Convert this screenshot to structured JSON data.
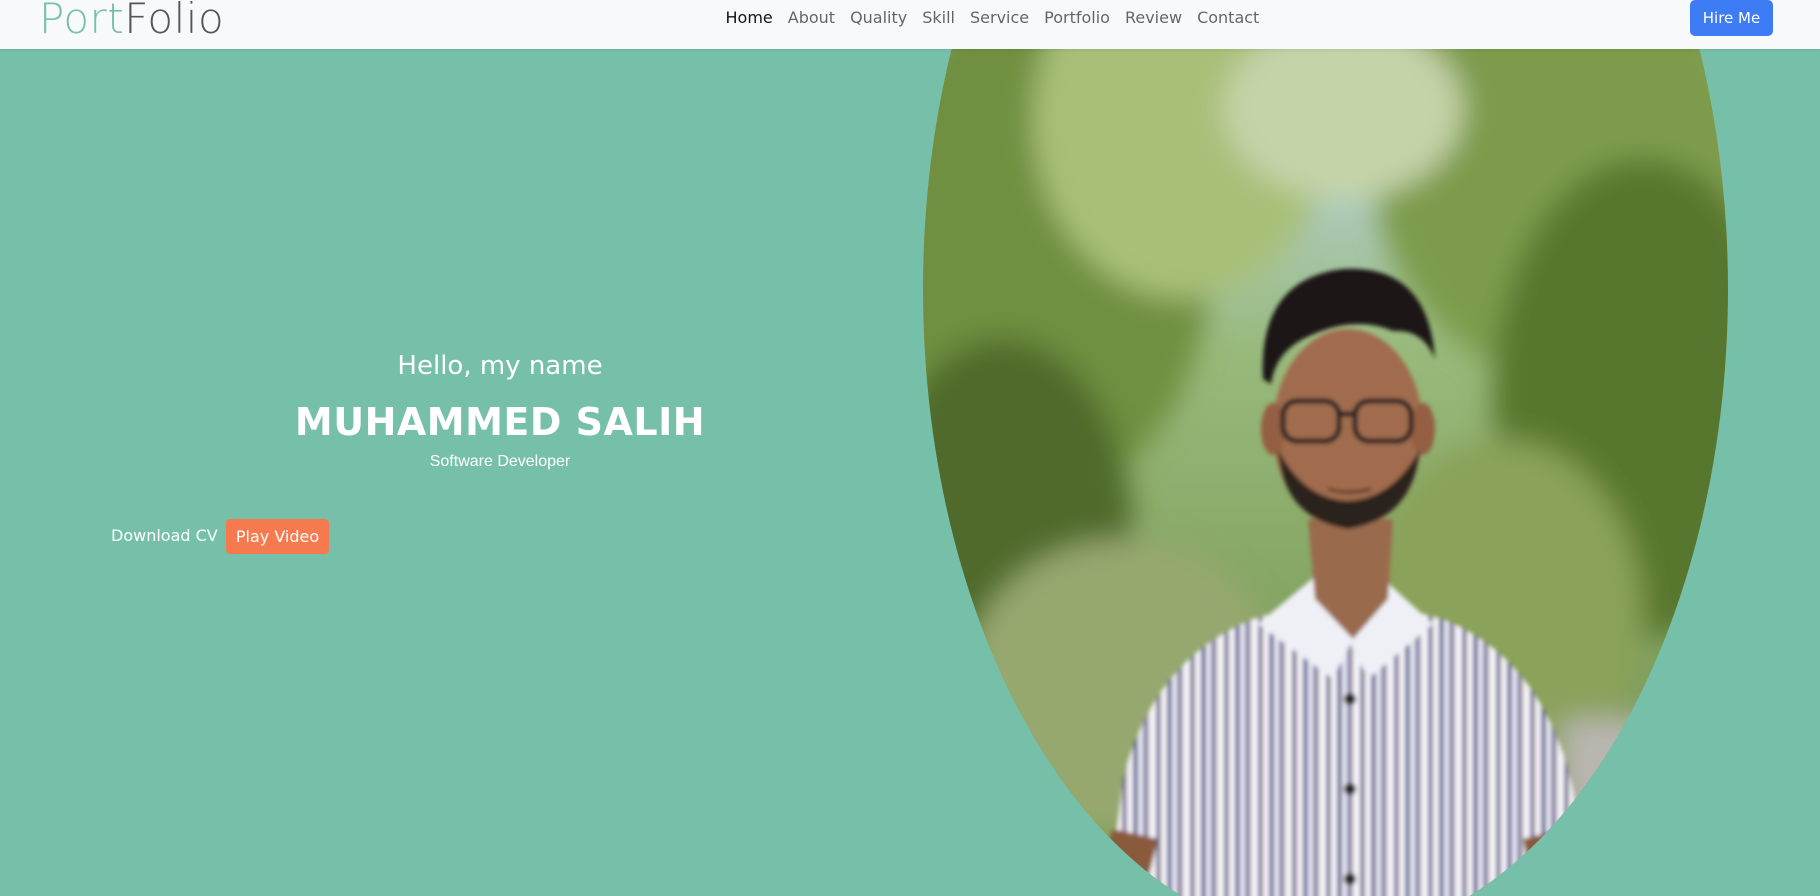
{
  "brand": {
    "part1": "Port",
    "part2": "Folio",
    "colors": {
      "part1": "#76c0aa",
      "part2": "#555555"
    }
  },
  "nav": {
    "items": [
      {
        "label": "Home",
        "active": true
      },
      {
        "label": "About",
        "active": false
      },
      {
        "label": "Quality",
        "active": false
      },
      {
        "label": "Skill",
        "active": false
      },
      {
        "label": "Service",
        "active": false
      },
      {
        "label": "Portfolio",
        "active": false
      },
      {
        "label": "Review",
        "active": false
      },
      {
        "label": "Contact",
        "active": false
      }
    ],
    "hire_label": "Hire Me"
  },
  "hero": {
    "greeting": "Hello, my name",
    "name": "MUHAMMED SALIH",
    "role": "Software Developer",
    "download_label": "Download CV",
    "play_label": "Play Video",
    "portrait_icon": "profile-photo"
  },
  "colors": {
    "background": "#76c0aa",
    "navbar": "#f8f9fa",
    "hire_button": "#3e7cf5",
    "play_button": "#f67a4f",
    "text_light": "#ffffff"
  }
}
